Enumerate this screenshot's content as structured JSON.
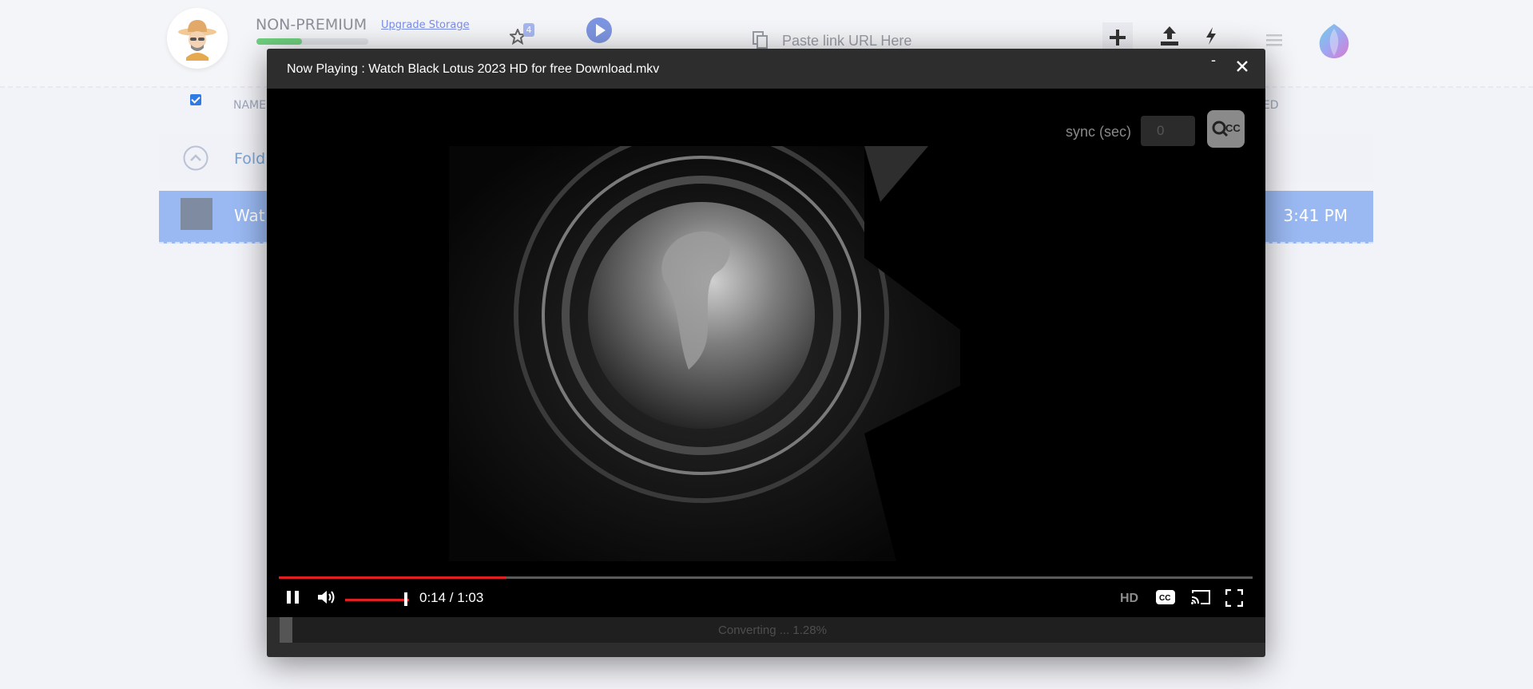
{
  "account": {
    "plan": "NON-PREMIUM",
    "upgrade_link": "Upgrade Storage",
    "storage_used_fraction": 0.41,
    "favorites_count": "4"
  },
  "search": {
    "placeholder": "Paste link URL Here"
  },
  "toolbar": {
    "icons": [
      "plus-icon",
      "upload-icon",
      "lightning-icon",
      "menu-icon"
    ]
  },
  "file_list": {
    "columns": {
      "name": "NAME",
      "changed": "GED"
    },
    "folder_row": {
      "label": "Fold"
    },
    "file_row": {
      "label": "Wat",
      "date": "3:41 PM"
    }
  },
  "player": {
    "title": "Now Playing : Watch Black Lotus 2023 HD for free Download.mkv",
    "minimize_label": "-",
    "sync_label": "sync (sec)",
    "sync_value": "0",
    "time_display": "0:14 / 1:03",
    "progress_fraction": 0.2333,
    "volume_fraction": 1.0,
    "quality_label": "HD",
    "converting_text": "Converting ... 1.28%",
    "converting_fraction": 0.0128
  },
  "colors": {
    "accent_red": "#e02020",
    "selected_row": "#9ab9f2",
    "modal_bg": "#2d2d2d"
  }
}
